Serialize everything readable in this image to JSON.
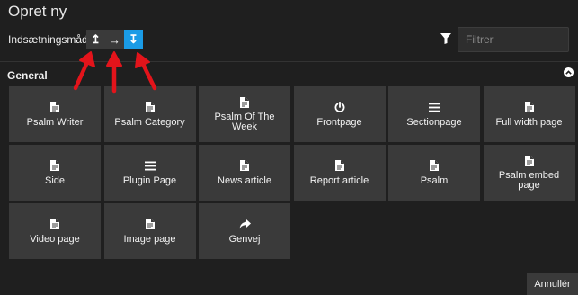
{
  "dialog": {
    "title": "Opret ny"
  },
  "insert_mode": {
    "label": "Indsætningsmåde",
    "buttons": [
      {
        "glyph": "↥",
        "icon": "insert-above-icon",
        "active": false
      },
      {
        "glyph": "→",
        "icon": "insert-after-icon",
        "active": false
      },
      {
        "glyph": "↧",
        "icon": "insert-below-icon",
        "active": true
      }
    ]
  },
  "filter": {
    "icon": "funnel-icon",
    "placeholder": "Filtrer",
    "value": ""
  },
  "section": {
    "title": "General",
    "collapse_icon": "chevron-up-circle-icon"
  },
  "tiles": [
    {
      "label": "Psalm Writer",
      "icon": "document-icon"
    },
    {
      "label": "Psalm Category",
      "icon": "document-icon"
    },
    {
      "label": "Psalm Of The Week",
      "icon": "document-icon"
    },
    {
      "label": "Frontpage",
      "icon": "power-icon"
    },
    {
      "label": "Sectionpage",
      "icon": "list-icon"
    },
    {
      "label": "Full width page",
      "icon": "document-icon"
    },
    {
      "label": "Side",
      "icon": "document-icon"
    },
    {
      "label": "Plugin Page",
      "icon": "list-icon"
    },
    {
      "label": "News article",
      "icon": "document-icon"
    },
    {
      "label": "Report article",
      "icon": "document-icon"
    },
    {
      "label": "Psalm",
      "icon": "document-icon"
    },
    {
      "label": "Psalm embed page",
      "icon": "document-icon"
    },
    {
      "label": "Video page",
      "icon": "document-icon"
    },
    {
      "label": "Image page",
      "icon": "document-icon"
    },
    {
      "label": "Genvej",
      "icon": "share-arrow-icon"
    }
  ],
  "footer": {
    "cancel_label": "Annullér"
  },
  "colors": {
    "background": "#1f1f1f",
    "tile": "#3a3a3a",
    "accent": "#1a9be6",
    "annotation": "#e3141b"
  }
}
